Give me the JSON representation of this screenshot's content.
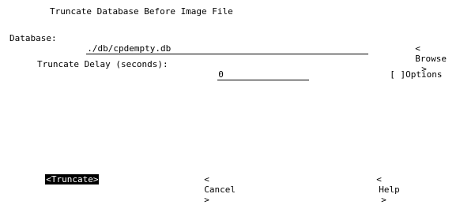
{
  "dialog": {
    "title": "Truncate Database Before Image File"
  },
  "database": {
    "label": "Database:",
    "value": "./db/cpdempty.db"
  },
  "browse_button": {
    "left": "<",
    "label": "Browse",
    "right": ">"
  },
  "delay": {
    "label": "Truncate Delay (seconds):",
    "value": "0"
  },
  "options_checkbox": {
    "box": "[ ]",
    "label": "Options"
  },
  "buttons": {
    "truncate": "<Truncate>",
    "cancel_left": "<",
    "cancel": "Cancel",
    "cancel_right": ">",
    "help_left": "<",
    "help": "Help",
    "help_right": ">"
  }
}
